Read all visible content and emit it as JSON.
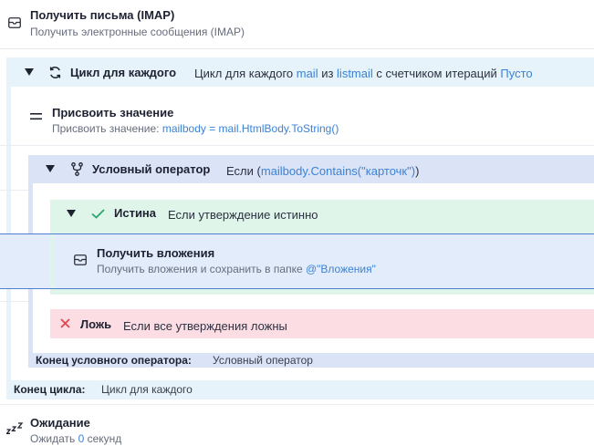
{
  "steps": {
    "imap": {
      "title": "Получить письма (IMAP)",
      "subtitle": "Получить электронные сообщения (IMAP)"
    },
    "foreach": {
      "title": "Цикл для каждого",
      "desc_prefix": "Цикл для каждого ",
      "item_var": "mail",
      "in_word": " из ",
      "list_var": "listmail",
      "counter_text": " с счетчиком итераций ",
      "counter_value": "Пусто"
    },
    "assign": {
      "title": "Присвоить значение",
      "subtitle_prefix": "Присвоить значение: ",
      "expression": "mailbody = mail.HtmlBody.ToString()"
    },
    "if": {
      "title": "Условный оператор",
      "cond_prefix": "Если (",
      "condition": "mailbody.Contains(\"карточк\")",
      "cond_suffix": ")"
    },
    "true_branch": {
      "title": "Истина",
      "desc": "Если утверждение истинно"
    },
    "attachments": {
      "title": "Получить вложения",
      "subtitle_prefix": "Получить вложения и сохранить в папке ",
      "folder": "@\"Вложения\""
    },
    "false_branch": {
      "title": "Ложь",
      "desc": "Если все утверждения ложны"
    },
    "end_if": {
      "label": "Конец условного оператора:",
      "value": "Условный оператор"
    },
    "end_loop": {
      "label": "Конец цикла:",
      "value": "Цикл для каждого"
    },
    "wait": {
      "title": "Ожидание",
      "subtitle_prefix": "Ожидать ",
      "seconds": "0",
      "subtitle_suffix": " секунд"
    }
  },
  "icons": {
    "imap": "envelope-icon",
    "loop": "loop-arrows-icon",
    "assign": "equals-icon",
    "if": "branch-fork-icon",
    "true": "check-icon",
    "false": "x-icon",
    "attachments": "envelope-icon",
    "wait": "sleep-zzz-icon",
    "collapse": "triangle-down-icon"
  },
  "colors": {
    "link": "#3b82d6",
    "loop_bg": "#e6f3fb",
    "if_bg": "#dbe3f7",
    "true_bg": "#dff5ea",
    "selected_bg": "#e3ecfb",
    "selected_border": "#4e7fd3",
    "false_bg": "#fbdde3",
    "check": "#2aa66b",
    "cross": "#e2464f"
  }
}
